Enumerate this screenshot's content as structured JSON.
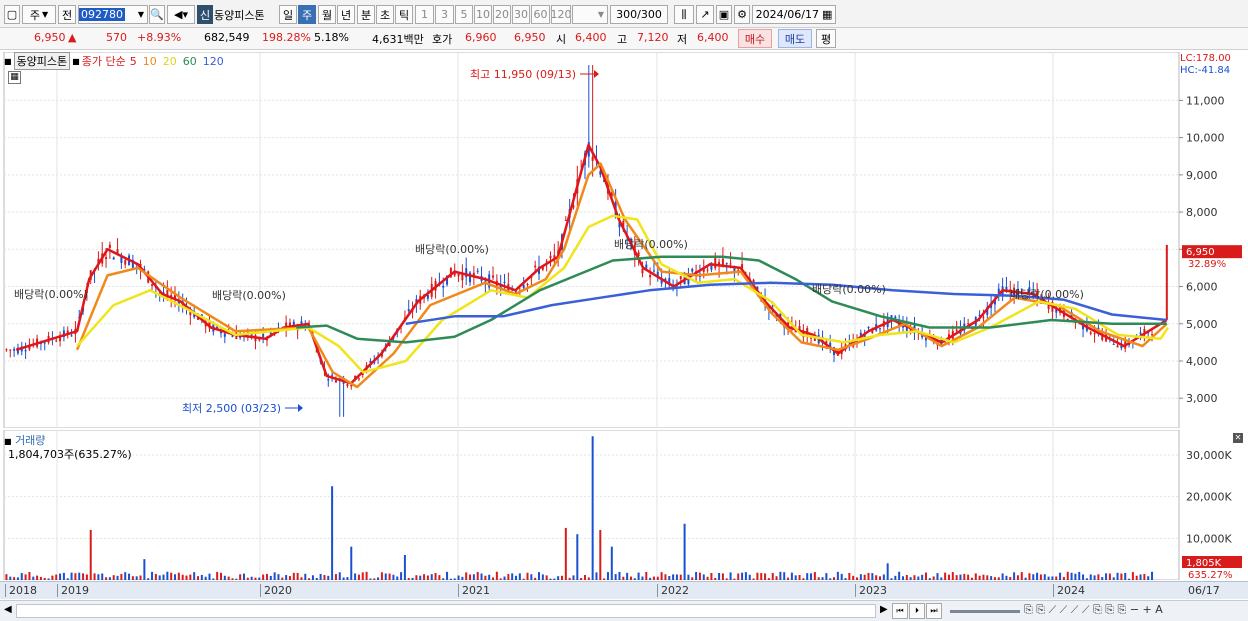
{
  "toolbar": {
    "period_unit": "주",
    "compare": "전",
    "code": "092780",
    "stock_name": "동양피스톤",
    "sin": "신",
    "periods": [
      "일",
      "주",
      "월",
      "년",
      "분",
      "초",
      "틱"
    ],
    "active_period": "주",
    "minutes": [
      "1",
      "3",
      "5",
      "10",
      "20",
      "30",
      "60",
      "120"
    ],
    "count": "300/300",
    "date": "2024/06/17"
  },
  "quote": {
    "price": "6,950",
    "change_arrow": "▲",
    "change": "570",
    "change_pct": "+8.93%",
    "volume": "682,549",
    "vol_ratio": "198.28%",
    "turnover": "5.18%",
    "amount": "4,631백만",
    "hoga_label": "호가",
    "hoga_value": "6,960",
    "hoga_value2": "6,950",
    "open_label": "시",
    "open": "6,400",
    "high_label": "고",
    "high": "7,120",
    "low_label": "저",
    "low": "6,400",
    "buy_label": "매수",
    "sell_label": "매도",
    "flat_label": "평"
  },
  "legend": {
    "name": "동양피스톤",
    "ma_label": "종가 단순",
    "periods": [
      "5",
      "10",
      "20",
      "60",
      "120"
    ]
  },
  "price_panel": {
    "lc": "LC:178.00",
    "hc": "HC:-41.84",
    "current": "6,950",
    "current_pct": "32.89%",
    "y_ticks": [
      "11,000",
      "10,000",
      "9,000",
      "8,000",
      "7,000",
      "6,000",
      "5,000",
      "4,000",
      "3,000"
    ]
  },
  "annotations": {
    "max": "최고 11,950 (09/13)",
    "min": "최저 2,500 (03/23)",
    "dividends": [
      "배당락(0.00%)",
      "배당락(0.00%)",
      "배당락(0.00%)",
      "배당락(0.00%)",
      "배당락(0.00%)",
      "배당락(0.00%)"
    ]
  },
  "volume_panel": {
    "title": "거래량",
    "value": "1,804,703주(635.27%)",
    "y_ticks": [
      "30,000K",
      "20,000K",
      "10,000K"
    ],
    "current": "1,805K",
    "current_pct": "635.27%"
  },
  "x_axis": {
    "labels": [
      "2018",
      "2019",
      "2020",
      "2021",
      "2022",
      "2023",
      "2024",
      "06/17"
    ]
  },
  "colors": {
    "up": "#d81b1b",
    "down": "#1a4fcf",
    "ma5": "#e0161b",
    "ma10": "#f0891a",
    "ma20": "#f0e41a",
    "ma60": "#2e8b57",
    "ma120": "#3a5fd9"
  },
  "chart_data": {
    "type": "candlestick",
    "title": "동양피스톤",
    "ylim": [
      2200,
      12300
    ],
    "series": [
      {
        "name": "5",
        "points": [
          [
            2018.0,
            4300
          ],
          [
            2018.5,
            4800
          ],
          [
            2018.6,
            6200
          ],
          [
            2018.75,
            7000
          ],
          [
            2019.0,
            6600
          ],
          [
            2019.2,
            5800
          ],
          [
            2019.35,
            5600
          ],
          [
            2019.6,
            4900
          ],
          [
            2019.8,
            4700
          ],
          [
            2020.05,
            4600
          ],
          [
            2020.2,
            4900
          ],
          [
            2020.4,
            5000
          ],
          [
            2020.55,
            3600
          ],
          [
            2020.75,
            3400
          ],
          [
            2021.0,
            4200
          ],
          [
            2021.3,
            5600
          ],
          [
            2021.6,
            6400
          ],
          [
            2021.85,
            6200
          ],
          [
            2022.1,
            5900
          ],
          [
            2022.3,
            6500
          ],
          [
            2022.45,
            6800
          ],
          [
            2022.7,
            9800
          ],
          [
            2022.8,
            9200
          ],
          [
            2022.95,
            7800
          ],
          [
            2023.15,
            6500
          ],
          [
            2023.4,
            6000
          ],
          [
            2023.7,
            6600
          ],
          [
            2023.95,
            6500
          ],
          [
            2024.15,
            5600
          ],
          [
            2024.35,
            4900
          ],
          [
            2024.55,
            4700
          ],
          [
            2024.75,
            4200
          ],
          [
            2025.0,
            4800
          ],
          [
            2025.2,
            5100
          ],
          [
            2025.4,
            4800
          ],
          [
            2025.6,
            4500
          ],
          [
            2025.9,
            5100
          ],
          [
            2026.1,
            5900
          ],
          [
            2026.35,
            5800
          ],
          [
            2026.55,
            5400
          ],
          [
            2026.8,
            4900
          ],
          [
            2027.1,
            4400
          ],
          [
            2027.45,
            5100
          ]
        ]
      },
      {
        "name": "10",
        "points": [
          [
            2018.5,
            4300
          ],
          [
            2018.75,
            6300
          ],
          [
            2019.0,
            6500
          ],
          [
            2019.35,
            5700
          ],
          [
            2019.8,
            4800
          ],
          [
            2020.4,
            4900
          ],
          [
            2020.6,
            3700
          ],
          [
            2020.8,
            3300
          ],
          [
            2021.1,
            4200
          ],
          [
            2021.4,
            5500
          ],
          [
            2021.85,
            6100
          ],
          [
            2022.1,
            5800
          ],
          [
            2022.35,
            6200
          ],
          [
            2022.5,
            7000
          ],
          [
            2022.7,
            9000
          ],
          [
            2022.8,
            9300
          ],
          [
            2023.0,
            7800
          ],
          [
            2023.3,
            6400
          ],
          [
            2023.6,
            6300
          ],
          [
            2023.95,
            6400
          ],
          [
            2024.2,
            5300
          ],
          [
            2024.45,
            4500
          ],
          [
            2024.75,
            4300
          ],
          [
            2025.0,
            4600
          ],
          [
            2025.3,
            5000
          ],
          [
            2025.6,
            4400
          ],
          [
            2025.9,
            4900
          ],
          [
            2026.2,
            5700
          ],
          [
            2026.55,
            5500
          ],
          [
            2026.9,
            4800
          ],
          [
            2027.25,
            4400
          ],
          [
            2027.45,
            5000
          ]
        ]
      },
      {
        "name": "20",
        "points": [
          [
            2018.5,
            4400
          ],
          [
            2018.8,
            5500
          ],
          [
            2019.1,
            5900
          ],
          [
            2019.4,
            5400
          ],
          [
            2019.8,
            4700
          ],
          [
            2020.4,
            4900
          ],
          [
            2020.65,
            4400
          ],
          [
            2020.85,
            3700
          ],
          [
            2021.2,
            4000
          ],
          [
            2021.5,
            5100
          ],
          [
            2021.9,
            5900
          ],
          [
            2022.2,
            5700
          ],
          [
            2022.5,
            6500
          ],
          [
            2022.7,
            7600
          ],
          [
            2022.9,
            7900
          ],
          [
            2023.1,
            7800
          ],
          [
            2023.3,
            6600
          ],
          [
            2023.6,
            6100
          ],
          [
            2023.9,
            6200
          ],
          [
            2024.2,
            5600
          ],
          [
            2024.45,
            4700
          ],
          [
            2024.8,
            4500
          ],
          [
            2025.1,
            4700
          ],
          [
            2025.4,
            4800
          ],
          [
            2025.7,
            4500
          ],
          [
            2026.0,
            4900
          ],
          [
            2026.4,
            5600
          ],
          [
            2026.7,
            5400
          ],
          [
            2027.05,
            4700
          ],
          [
            2027.4,
            4600
          ],
          [
            2027.46,
            4900
          ]
        ]
      },
      {
        "name": "60",
        "points": [
          [
            2020.3,
            4900
          ],
          [
            2020.55,
            4950
          ],
          [
            2020.8,
            4600
          ],
          [
            2021.2,
            4500
          ],
          [
            2021.6,
            4650
          ],
          [
            2021.9,
            5100
          ],
          [
            2022.3,
            5900
          ],
          [
            2022.6,
            6300
          ],
          [
            2022.9,
            6700
          ],
          [
            2023.3,
            6800
          ],
          [
            2023.8,
            6800
          ],
          [
            2024.1,
            6700
          ],
          [
            2024.4,
            6200
          ],
          [
            2024.7,
            5600
          ],
          [
            2025.1,
            5200
          ],
          [
            2025.5,
            4900
          ],
          [
            2026.0,
            4900
          ],
          [
            2026.5,
            5100
          ],
          [
            2027.0,
            5000
          ],
          [
            2027.45,
            5000
          ]
        ]
      },
      {
        "name": "120",
        "points": [
          [
            2021.2,
            5000
          ],
          [
            2021.6,
            5200
          ],
          [
            2022.0,
            5200
          ],
          [
            2022.4,
            5500
          ],
          [
            2022.8,
            5700
          ],
          [
            2023.2,
            5900
          ],
          [
            2023.7,
            6050
          ],
          [
            2024.2,
            6100
          ],
          [
            2024.7,
            6050
          ],
          [
            2025.2,
            5900
          ],
          [
            2025.7,
            5800
          ],
          [
            2026.2,
            5750
          ],
          [
            2026.6,
            5650
          ],
          [
            2027.0,
            5250
          ],
          [
            2027.45,
            5100
          ]
        ]
      }
    ]
  }
}
